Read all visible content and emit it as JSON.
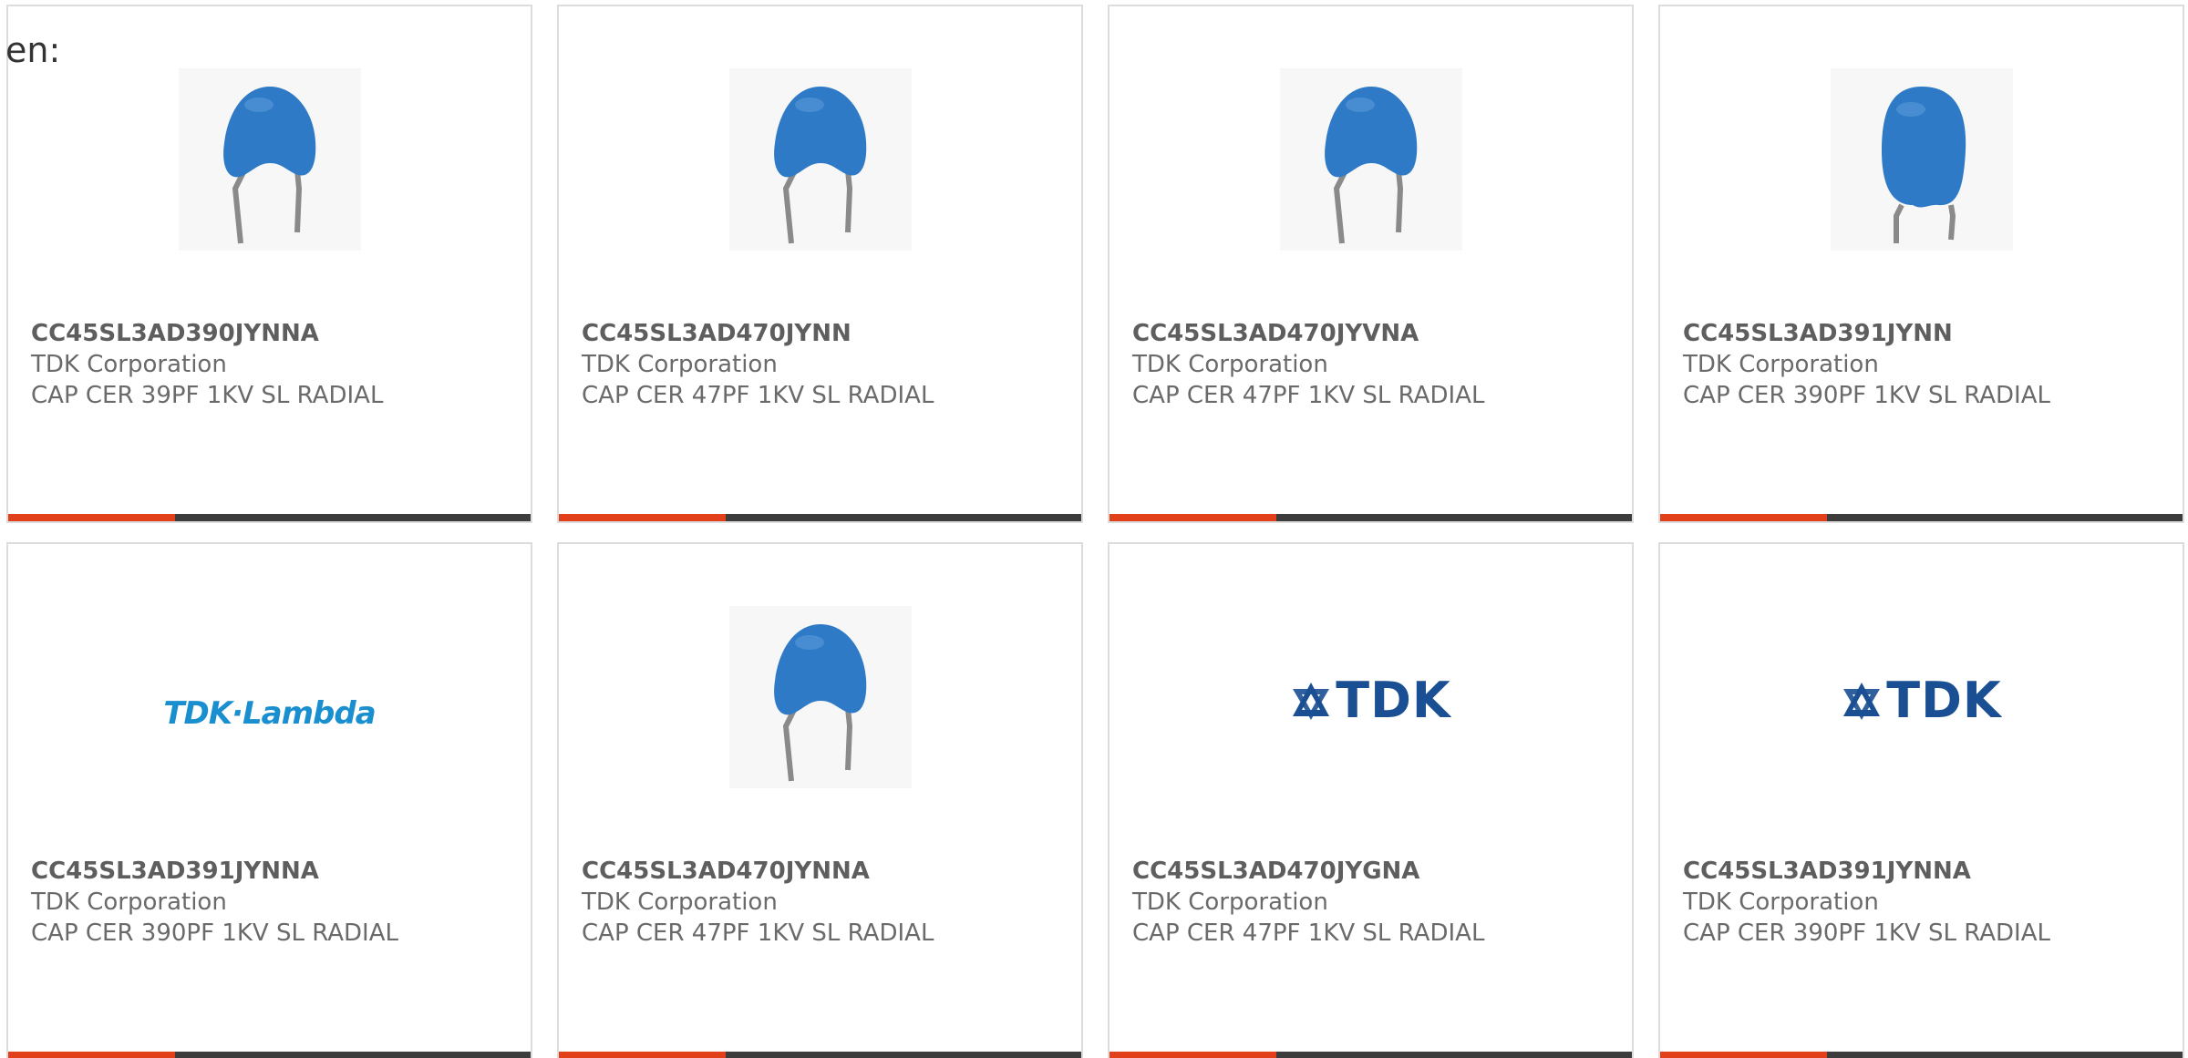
{
  "language_label": "en:",
  "colors": {
    "capacitor_body": "#2f7ac6",
    "capacitor_leads": "#8a8a8a",
    "accent_bar": "#e2401a",
    "dark_bar": "#3c3c3c",
    "tdk_blue": "#1b4f94",
    "lambda_blue": "#1a8fd0"
  },
  "products": [
    {
      "part_number": "CC45SL3AD390JYNNA",
      "manufacturer": "TDK Corporation",
      "description": "CAP CER 39PF 1KV SL RADIAL",
      "image": "blue-capacitor-photo"
    },
    {
      "part_number": "CC45SL3AD470JYNN",
      "manufacturer": "TDK Corporation",
      "description": "CAP CER 47PF 1KV SL RADIAL",
      "image": "blue-capacitor-photo"
    },
    {
      "part_number": "CC45SL3AD470JYVNA",
      "manufacturer": "TDK Corporation",
      "description": "CAP CER 47PF 1KV SL RADIAL",
      "image": "blue-capacitor-photo"
    },
    {
      "part_number": "CC45SL3AD391JYNN",
      "manufacturer": "TDK Corporation",
      "description": "CAP CER 390PF 1KV SL RADIAL",
      "image": "blue-capacitor-tall-photo"
    },
    {
      "part_number": "CC45SL3AD391JYNNA",
      "manufacturer": "TDK Corporation",
      "description": "CAP CER 390PF 1KV SL RADIAL",
      "image": "tdk-lambda-logo",
      "logo_text": "TDK·Lambda"
    },
    {
      "part_number": "CC45SL3AD470JYNNA",
      "manufacturer": "TDK Corporation",
      "description": "CAP CER 47PF 1KV SL RADIAL",
      "image": "blue-capacitor-photo"
    },
    {
      "part_number": "CC45SL3AD470JYGNA",
      "manufacturer": "TDK Corporation",
      "description": "CAP CER 47PF 1KV SL RADIAL",
      "image": "tdk-logo",
      "logo_text": "TDK"
    },
    {
      "part_number": "CC45SL3AD391JYNNA",
      "manufacturer": "TDK Corporation",
      "description": "CAP CER 390PF 1KV SL RADIAL",
      "image": "tdk-logo",
      "logo_text": "TDK"
    }
  ]
}
